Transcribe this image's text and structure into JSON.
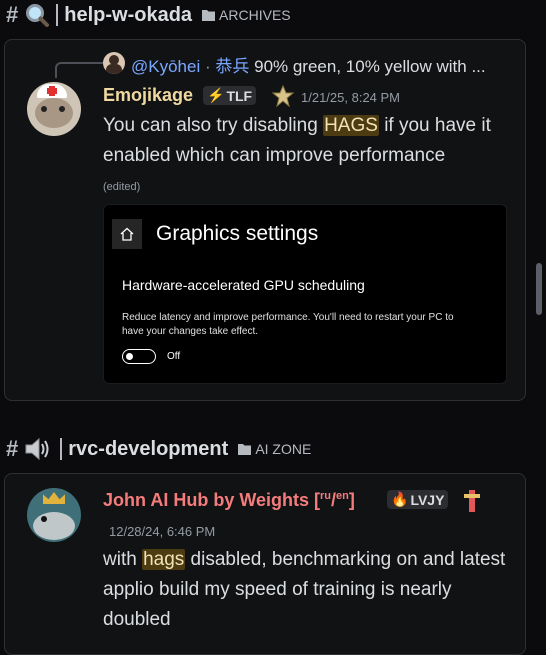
{
  "thread1": {
    "channel": "help-w-okada",
    "category": "ARCHIVES",
    "reply": {
      "name": "@Kyōhei",
      "nick": "恭兵",
      "preview": "90% green, 10% yellow with ..."
    },
    "message": {
      "author": "Emojikage",
      "badge": "TLF",
      "time": "1/21/25, 8:24 PM",
      "text_before": "You can also try disabling ",
      "highlight": "HAGS",
      "text_after": " if you have it enabled which can improve performance",
      "edited": "(edited)"
    },
    "attachment": {
      "title": "Graphics settings",
      "setting": "Hardware-accelerated GPU scheduling",
      "description": "Reduce latency and improve performance. You'll need to restart your PC to have your changes take effect.",
      "toggle_label": "Off"
    }
  },
  "thread2": {
    "channel": "rvc-development",
    "category": "AI ZONE",
    "message": {
      "author_main": "John AI Hub by Weights [",
      "author_sup1": "ru",
      "author_slash": "/",
      "author_sup2": "en",
      "author_end": "]",
      "badge": "LVJY",
      "time": "12/28/24, 6:46 PM",
      "text_before": "with ",
      "highlight": "hags",
      "text_after": " disabled, benchmarking on and latest applio build my speed of training is nearly doubled"
    }
  },
  "colors": {
    "author1": "#f0d9a0",
    "author2": "#f47c7c",
    "link": "#7aa7ff",
    "highlight_bg": "#4d3b12"
  }
}
